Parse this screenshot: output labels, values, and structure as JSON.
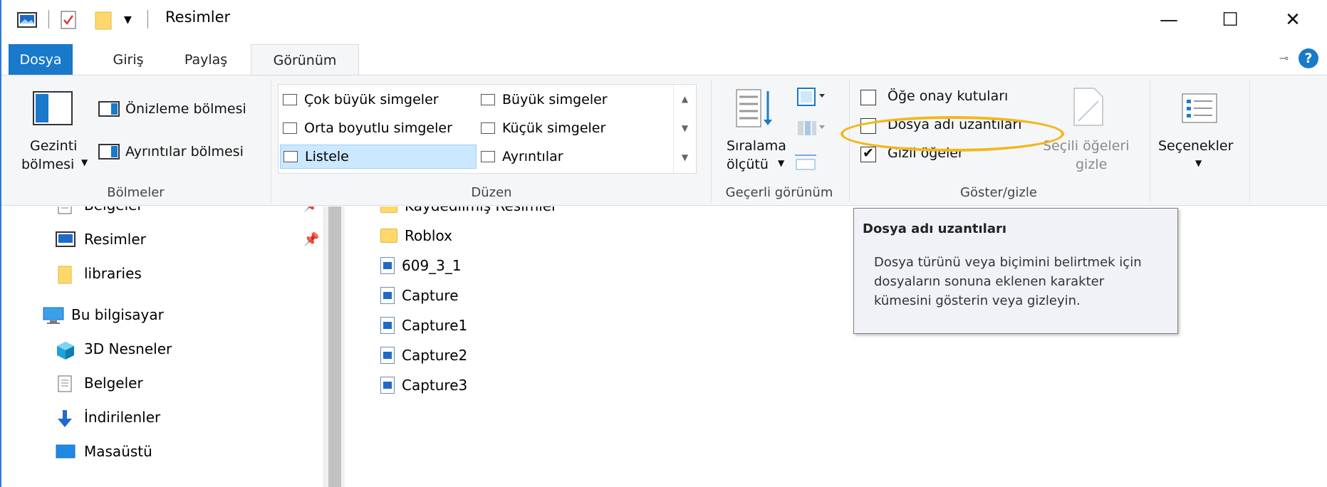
{
  "window": {
    "title": "Resimler",
    "minimize_glyph": "—",
    "maximize_glyph": "☐",
    "close_glyph": "✕"
  },
  "tabs": {
    "file": "Dosya",
    "home": "Giriş",
    "share": "Paylaş",
    "view": "Görünüm"
  },
  "help_glyph": "?",
  "ribbon": {
    "panes": {
      "nav_pane_line1": "Gezinti",
      "nav_pane_line2": "bölmesi",
      "preview_pane": "Önizleme bölmesi",
      "details_pane": "Ayrıntılar bölmesi",
      "group_label": "Bölmeler"
    },
    "layout": {
      "items": [
        "Çok büyük simgeler",
        "Büyük simgeler",
        "Orta boyutlu simgeler",
        "Küçük simgeler",
        "Listele",
        "Ayrıntılar"
      ],
      "selected": "Listele",
      "group_label": "Düzen"
    },
    "current_view": {
      "sort_line1": "Sıralama",
      "sort_line2": "ölçütü",
      "group_label": "Geçerli görünüm"
    },
    "show_hide": {
      "item_checkboxes": "Öğe onay kutuları",
      "file_name_extensions": "Dosya adı uzantıları",
      "hidden_items": "Gizli öğeler",
      "hide_selected_line1": "Seçili öğeleri",
      "hide_selected_line2": "gizle",
      "group_label": "Göster/gizle"
    },
    "options": {
      "label": "Seçenekler"
    }
  },
  "checkbox_state": {
    "item_checkboxes": false,
    "file_name_extensions": false,
    "hidden_items": true
  },
  "nav_pane": {
    "items": [
      {
        "label": "Belgeler",
        "icon": "document-icon"
      },
      {
        "label": "Resimler",
        "icon": "pictures-icon"
      },
      {
        "label": "libraries",
        "icon": "folder-icon"
      },
      {
        "label": "Bu bilgisayar",
        "icon": "computer-icon"
      },
      {
        "label": "3D Nesneler",
        "icon": "3d-objects-icon"
      },
      {
        "label": "Belgeler",
        "icon": "document-icon"
      },
      {
        "label": "İndirilenler",
        "icon": "download-icon"
      },
      {
        "label": "Masaüstü",
        "icon": "desktop-icon"
      }
    ]
  },
  "content": {
    "items": [
      {
        "label": "Kaydedilmiş Resimler",
        "type": "folder"
      },
      {
        "label": "Roblox",
        "type": "folder"
      },
      {
        "label": "609_3_1",
        "type": "image"
      },
      {
        "label": "Capture",
        "type": "image"
      },
      {
        "label": "Capture1",
        "type": "image"
      },
      {
        "label": "Capture2",
        "type": "image"
      },
      {
        "label": "Capture3",
        "type": "image"
      }
    ]
  },
  "tooltip": {
    "title": "Dosya adı uzantıları",
    "body": "Dosya türünü veya biçimini belirtmek için dosyaların sonuna eklenen karakter kümesini gösterin veya gizleyin."
  },
  "colors": {
    "accent": "#1979ca",
    "highlight_ring": "#f2b71b",
    "selected_bg": "#cce8ff",
    "folder": "#ffd86b"
  }
}
